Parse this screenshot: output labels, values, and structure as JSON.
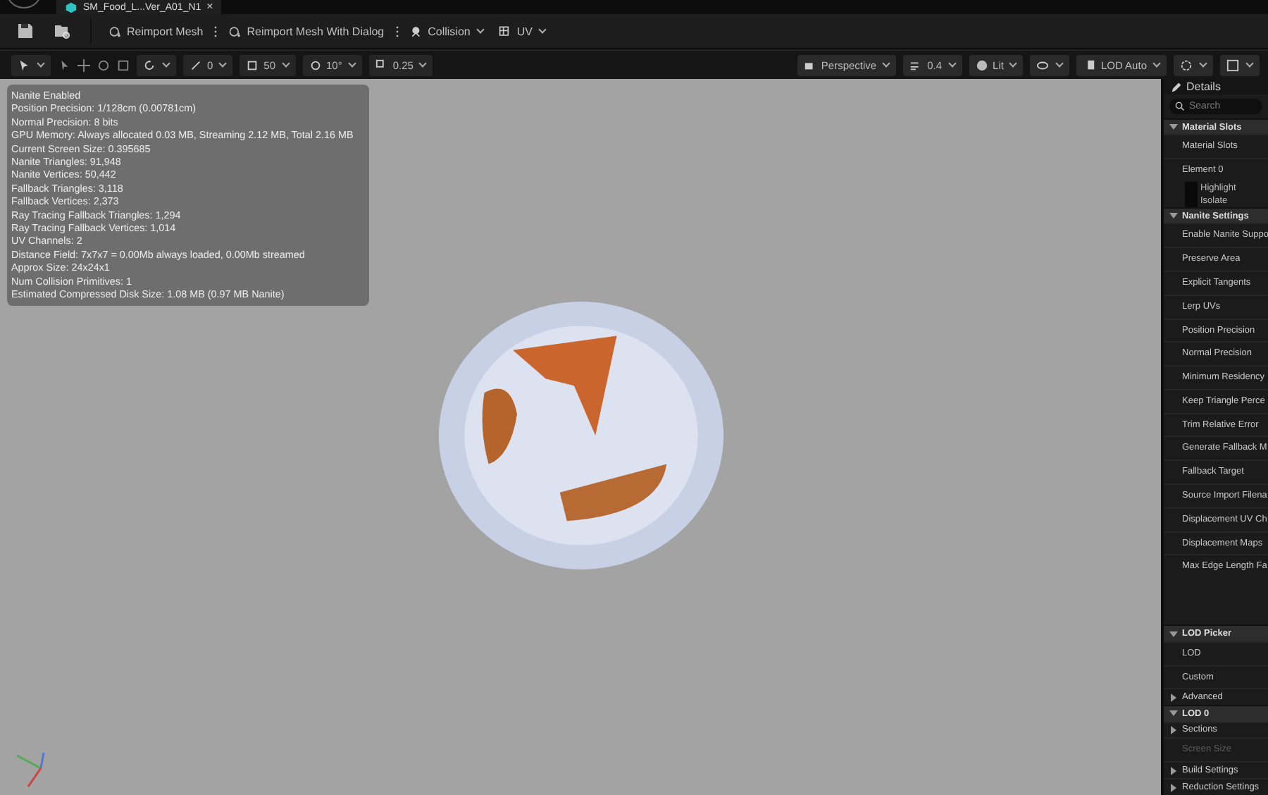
{
  "tab": {
    "title": "SM_Food_L...Ver_A01_N1",
    "close": "×"
  },
  "toolbar": {
    "buttons": [
      {
        "label": "Reimport Mesh",
        "kind": "reimport"
      },
      {
        "label": "Reimport Mesh With Dialog",
        "kind": "reimport"
      },
      {
        "label": "Collision",
        "kind": "collision"
      },
      {
        "label": "UV",
        "kind": "uv"
      }
    ]
  },
  "viewport_toolbar": {
    "left": [
      {
        "label": "0",
        "kind": "scale"
      },
      {
        "label": "50",
        "kind": "grid"
      },
      {
        "label": "10°",
        "kind": "rotate"
      },
      {
        "label": "0.25",
        "kind": "snap"
      }
    ],
    "right": [
      {
        "label": "Perspective",
        "kind": "camera"
      },
      {
        "label": "0.4",
        "kind": "speed"
      },
      {
        "label": "Lit",
        "kind": "lit"
      },
      {
        "kind": "show"
      },
      {
        "label": "LOD Auto",
        "kind": "lod"
      }
    ]
  },
  "stats": [
    "Nanite Enabled",
    "Position Precision: 1/128cm (0.00781cm)",
    "Normal Precision: 8 bits",
    "GPU Memory: Always allocated 0.03 MB, Streaming 2.12 MB, Total 2.16 MB",
    "Current Screen Size: 0.395685",
    "Nanite Triangles: 91,948",
    "Nanite Vertices: 50,442",
    "Fallback Triangles: 3,118",
    "Fallback Vertices: 2,373",
    "Ray Tracing Fallback Triangles: 1,294",
    "Ray Tracing Fallback Vertices: 1,014",
    "UV Channels: 2",
    "Distance Field: 7x7x7 = 0.00Mb always loaded, 0.00Mb streamed",
    "Approx Size: 24x24x1",
    "Num Collision Primitives: 1",
    "Estimated Compressed Disk Size: 1.08 MB (0.97 MB Nanite)"
  ],
  "details": {
    "title": "Details",
    "search": {
      "placeholder": "Search"
    },
    "items": [
      {
        "kind": "section",
        "label": "Material Slots",
        "expanded": true
      },
      {
        "kind": "row",
        "label": "Material Slots",
        "disabled": false
      },
      {
        "kind": "row",
        "label": "Element 0",
        "disabled": false
      },
      {
        "kind": "check",
        "label": "Highlight",
        "checked": false
      },
      {
        "kind": "check",
        "label": "Isolate",
        "checked": false
      },
      {
        "kind": "section",
        "label": "Nanite Settings",
        "expanded": true
      },
      {
        "kind": "row",
        "label": "Enable Nanite Suppo",
        "disabled": false
      },
      {
        "kind": "row",
        "label": "Preserve Area",
        "disabled": false
      },
      {
        "kind": "row",
        "label": "Explicit Tangents",
        "disabled": false
      },
      {
        "kind": "row",
        "label": "Lerp UVs",
        "disabled": false
      },
      {
        "kind": "row",
        "label": "Position Precision",
        "disabled": false
      },
      {
        "kind": "row",
        "label": "Normal Precision",
        "disabled": false
      },
      {
        "kind": "row",
        "label": "Minimum Residency",
        "disabled": false
      },
      {
        "kind": "row",
        "label": "Keep Triangle Perce",
        "disabled": false
      },
      {
        "kind": "row",
        "label": "Trim Relative Error",
        "disabled": false
      },
      {
        "kind": "row",
        "label": "Generate Fallback M",
        "disabled": false
      },
      {
        "kind": "row",
        "label": "Fallback Target",
        "disabled": false
      },
      {
        "kind": "row",
        "label": "Source Import Filena",
        "disabled": false
      },
      {
        "kind": "row",
        "label": "Displacement UV Ch",
        "disabled": false
      },
      {
        "kind": "row",
        "label": "Displacement Maps",
        "disabled": false
      },
      {
        "kind": "row",
        "label": "Max Edge Length Fa",
        "disabled": false
      },
      {
        "kind": "spacer"
      },
      {
        "kind": "section",
        "label": "LOD Picker",
        "expanded": true
      },
      {
        "kind": "row",
        "label": "LOD",
        "disabled": false
      },
      {
        "kind": "row",
        "label": "Custom",
        "disabled": false
      },
      {
        "kind": "group",
        "label": "Advanced",
        "expanded": false
      },
      {
        "kind": "section",
        "label": "LOD 0",
        "expanded": true
      },
      {
        "kind": "group",
        "label": "Sections",
        "expanded": false
      },
      {
        "kind": "row",
        "label": "Screen Size",
        "disabled": true
      },
      {
        "kind": "group",
        "label": "Build Settings",
        "expanded": false
      },
      {
        "kind": "group",
        "label": "Reduction Settings",
        "expanded": false
      }
    ]
  }
}
